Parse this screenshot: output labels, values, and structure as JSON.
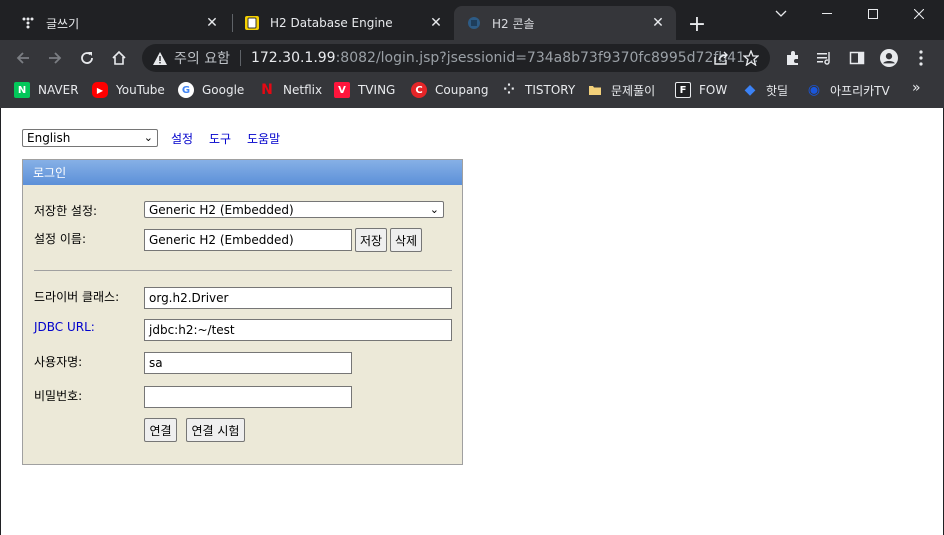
{
  "browser": {
    "tabs": [
      {
        "title": "글쓰기",
        "icon": "tistory-icon"
      },
      {
        "title": "H2 Database Engine",
        "icon": "h2-icon"
      },
      {
        "title": "H2 콘솔",
        "icon": "h2-console-icon",
        "active": true
      }
    ],
    "address": {
      "security_label": "주의 요함",
      "host": "172.30.1.99",
      "path": ":8082/login.jsp?jsessionid=734a8b73f9370fc8995d72fb41..."
    },
    "bookmarks": [
      {
        "label": "NAVER",
        "color": "#03c75a",
        "glyph": "N"
      },
      {
        "label": "YouTube",
        "color": "#ff0000",
        "glyph": "▶"
      },
      {
        "label": "Google",
        "color": "#ffffff",
        "glyph": "G"
      },
      {
        "label": "Netflix",
        "color": "#e50914",
        "glyph": "N"
      },
      {
        "label": "TVING",
        "color": "#ff153c",
        "glyph": "V"
      },
      {
        "label": "Coupang",
        "color": "#e52528",
        "glyph": "C"
      },
      {
        "label": "TISTORY",
        "color": "#ffffff",
        "glyph": "⁘"
      },
      {
        "label": "문제풀이",
        "color": "#f2d07a",
        "glyph": ""
      },
      {
        "label": "FOW",
        "color": "#ffffff",
        "glyph": "F"
      },
      {
        "label": "핫딜",
        "color": "#3b82f6",
        "glyph": "◆"
      },
      {
        "label": "아프리카TV",
        "color": "#1a56db",
        "glyph": "◉"
      }
    ],
    "bookmarks_more": "»"
  },
  "page": {
    "language_select": "English",
    "links": {
      "settings": "설정",
      "tools": "도구",
      "help": "도움말"
    },
    "login": {
      "header": "로그인",
      "saved_settings_label": "저장한 설정:",
      "saved_settings_value": "Generic H2 (Embedded)",
      "setting_name_label": "설정 이름:",
      "setting_name_value": "Generic H2 (Embedded)",
      "save_button": "저장",
      "delete_button": "삭제",
      "driver_label": "드라이버 클래스:",
      "driver_value": "org.h2.Driver",
      "jdbc_label": "JDBC URL:",
      "jdbc_value": "jdbc:h2:~/test",
      "user_label": "사용자명:",
      "user_value": "sa",
      "password_label": "비밀번호:",
      "password_value": "",
      "connect_button": "연결",
      "test_button": "연결 시험"
    }
  }
}
